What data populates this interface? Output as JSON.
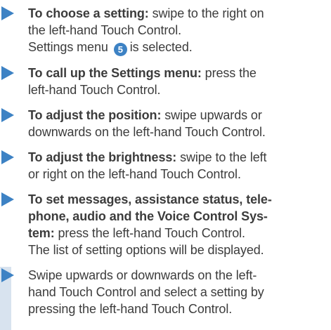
{
  "accent_color": "#3d82c4",
  "shade_color": "#d8e3ef",
  "steps": [
    {
      "lead": "To choose a setting:",
      "lines": [
        " swipe to the right on",
        "the left-hand Touch Control."
      ],
      "extra_before_badge": "Settings menu",
      "badge": "5",
      "extra_after_badge": "is selected."
    },
    {
      "lead": "To call up the Settings menu:",
      "lines": [
        " press the",
        "left-hand Touch Control."
      ]
    },
    {
      "lead": "To adjust the position:",
      "lines": [
        " swipe upwards or",
        "downwards on the left-hand Touch Control."
      ]
    },
    {
      "lead": "To adjust the brightness:",
      "lines": [
        " swipe to the left",
        "or right on the left-hand Touch Control."
      ]
    },
    {
      "lead_lines": [
        "To set messages, assistance status, tele-",
        "phone, audio and the Voice Control Sys-",
        "tem:"
      ],
      "lines": [
        " press the left-hand Touch Control.",
        "The list of setting options will be displayed."
      ]
    },
    {
      "lines": [
        "Swipe upwards or downwards on the left-",
        "hand Touch Control and select a setting by",
        "pressing the left-hand Touch Control."
      ]
    }
  ]
}
